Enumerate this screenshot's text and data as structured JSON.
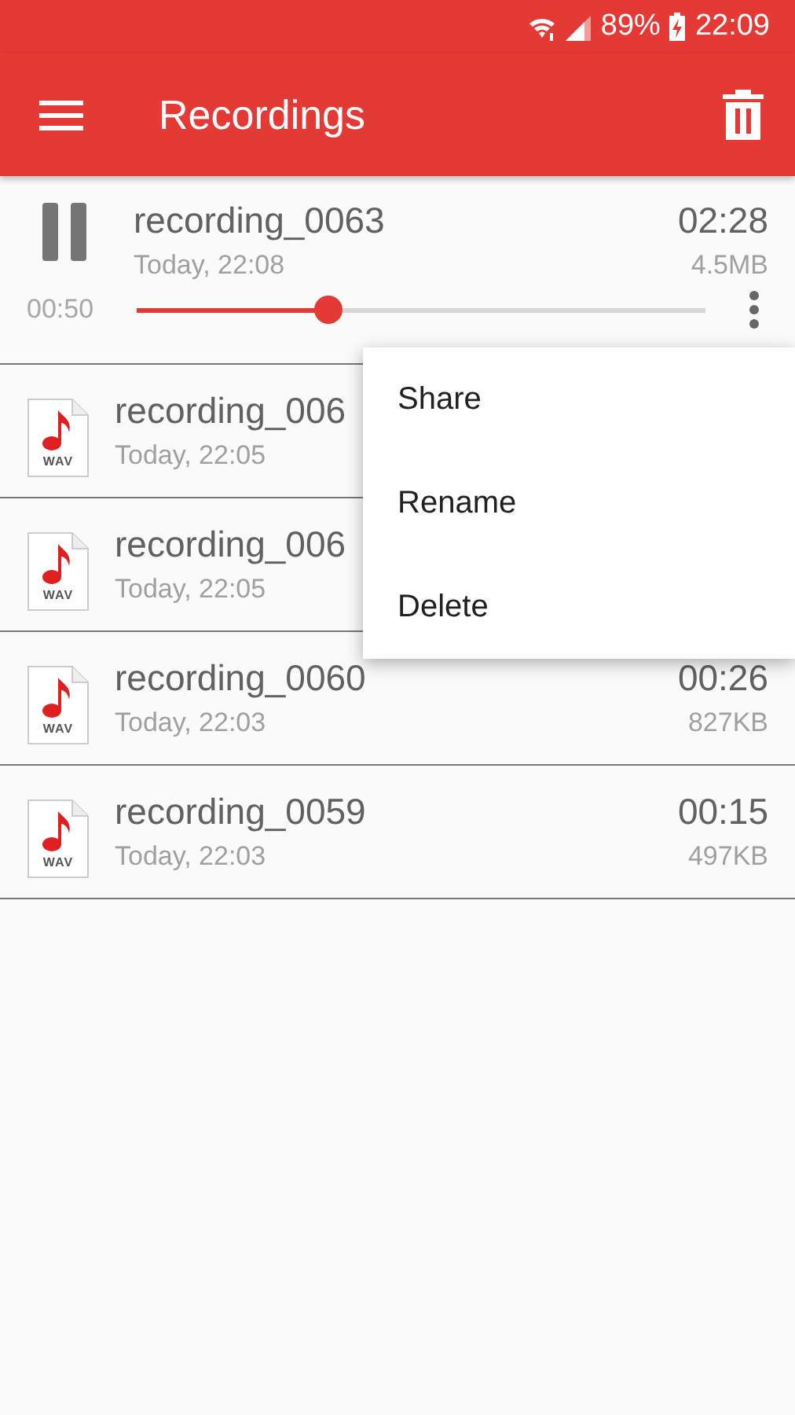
{
  "status_bar": {
    "battery": "89%",
    "time": "22:09"
  },
  "app_bar": {
    "title": "Recordings"
  },
  "player": {
    "name": "recording_0063",
    "date": "Today, 22:08",
    "duration": "02:28",
    "size": "4.5MB",
    "position": "00:50",
    "level": 0.337,
    "playing": true
  },
  "recordings": [
    {
      "badge": "WAV",
      "name": "recording_006",
      "date": "Today, 22:05"
    },
    {
      "badge": "WAV",
      "name": "recording_006",
      "date": "Today, 22:05"
    },
    {
      "badge": "WAV",
      "name": "recording_0060",
      "date": "Today, 22:03",
      "duration": "00:26",
      "size": "827KB"
    },
    {
      "badge": "WAV",
      "name": "recording_0059",
      "date": "Today, 22:03",
      "duration": "00:15",
      "size": "497KB"
    }
  ],
  "menu": [
    "Share",
    "Rename",
    "Delete"
  ]
}
